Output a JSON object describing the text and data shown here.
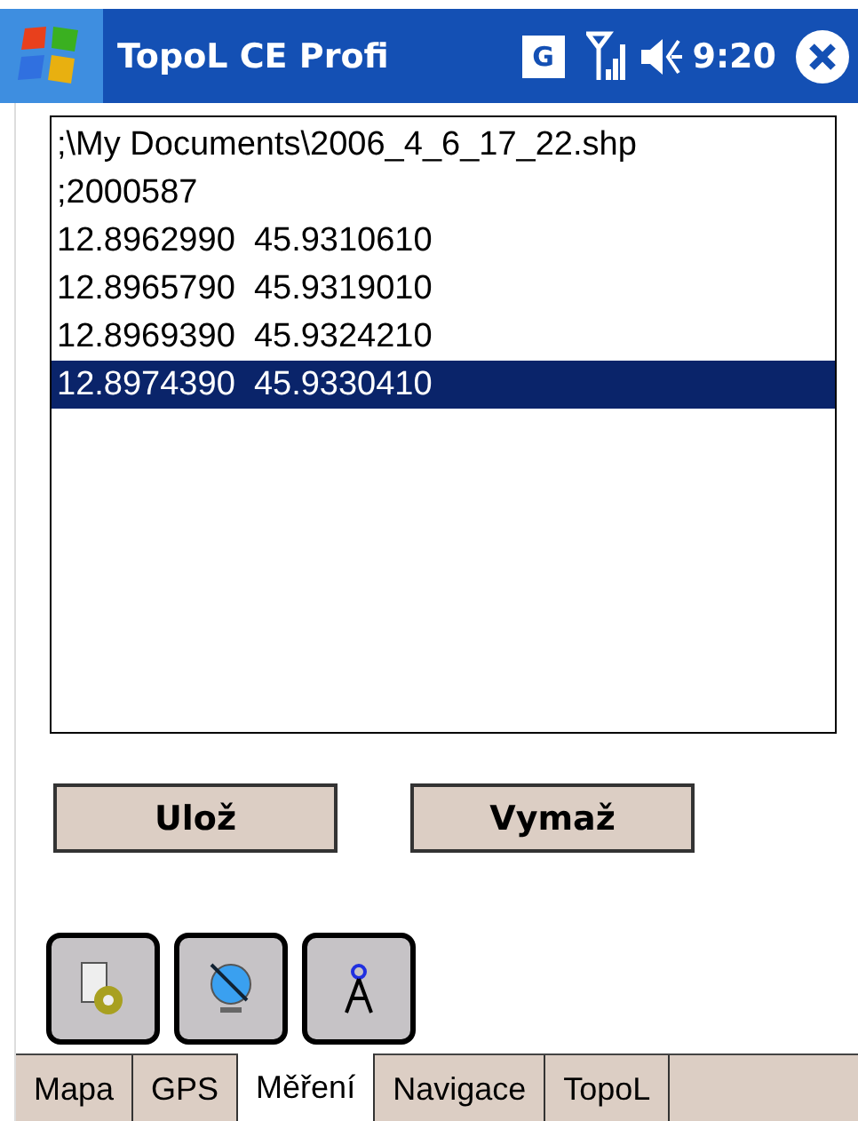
{
  "title_bar": {
    "title": "TopoL CE Profi",
    "network_badge": "G",
    "time": "9:20"
  },
  "list": {
    "rows": [
      {
        "text": ";\\My Documents\\2006_4_6_17_22.shp",
        "selected": false
      },
      {
        "text": ";2000587",
        "selected": false
      },
      {
        "text": "12.8962990  45.9310610",
        "selected": false
      },
      {
        "text": "12.8965790  45.9319010",
        "selected": false
      },
      {
        "text": "12.8969390  45.9324210",
        "selected": false
      },
      {
        "text": "12.8974390  45.9330410",
        "selected": true
      }
    ]
  },
  "buttons": [
    "Ulož",
    "Vymaž"
  ],
  "tools": [
    {
      "kind": "settings"
    },
    {
      "kind": "satellite"
    },
    {
      "kind": "compass"
    }
  ],
  "tabs": [
    {
      "label": "Mapa",
      "selected": false
    },
    {
      "label": "GPS",
      "selected": false
    },
    {
      "label": "Měření",
      "selected": true
    },
    {
      "label": "Navigace",
      "selected": false
    },
    {
      "label": "TopoL",
      "selected": false
    }
  ]
}
